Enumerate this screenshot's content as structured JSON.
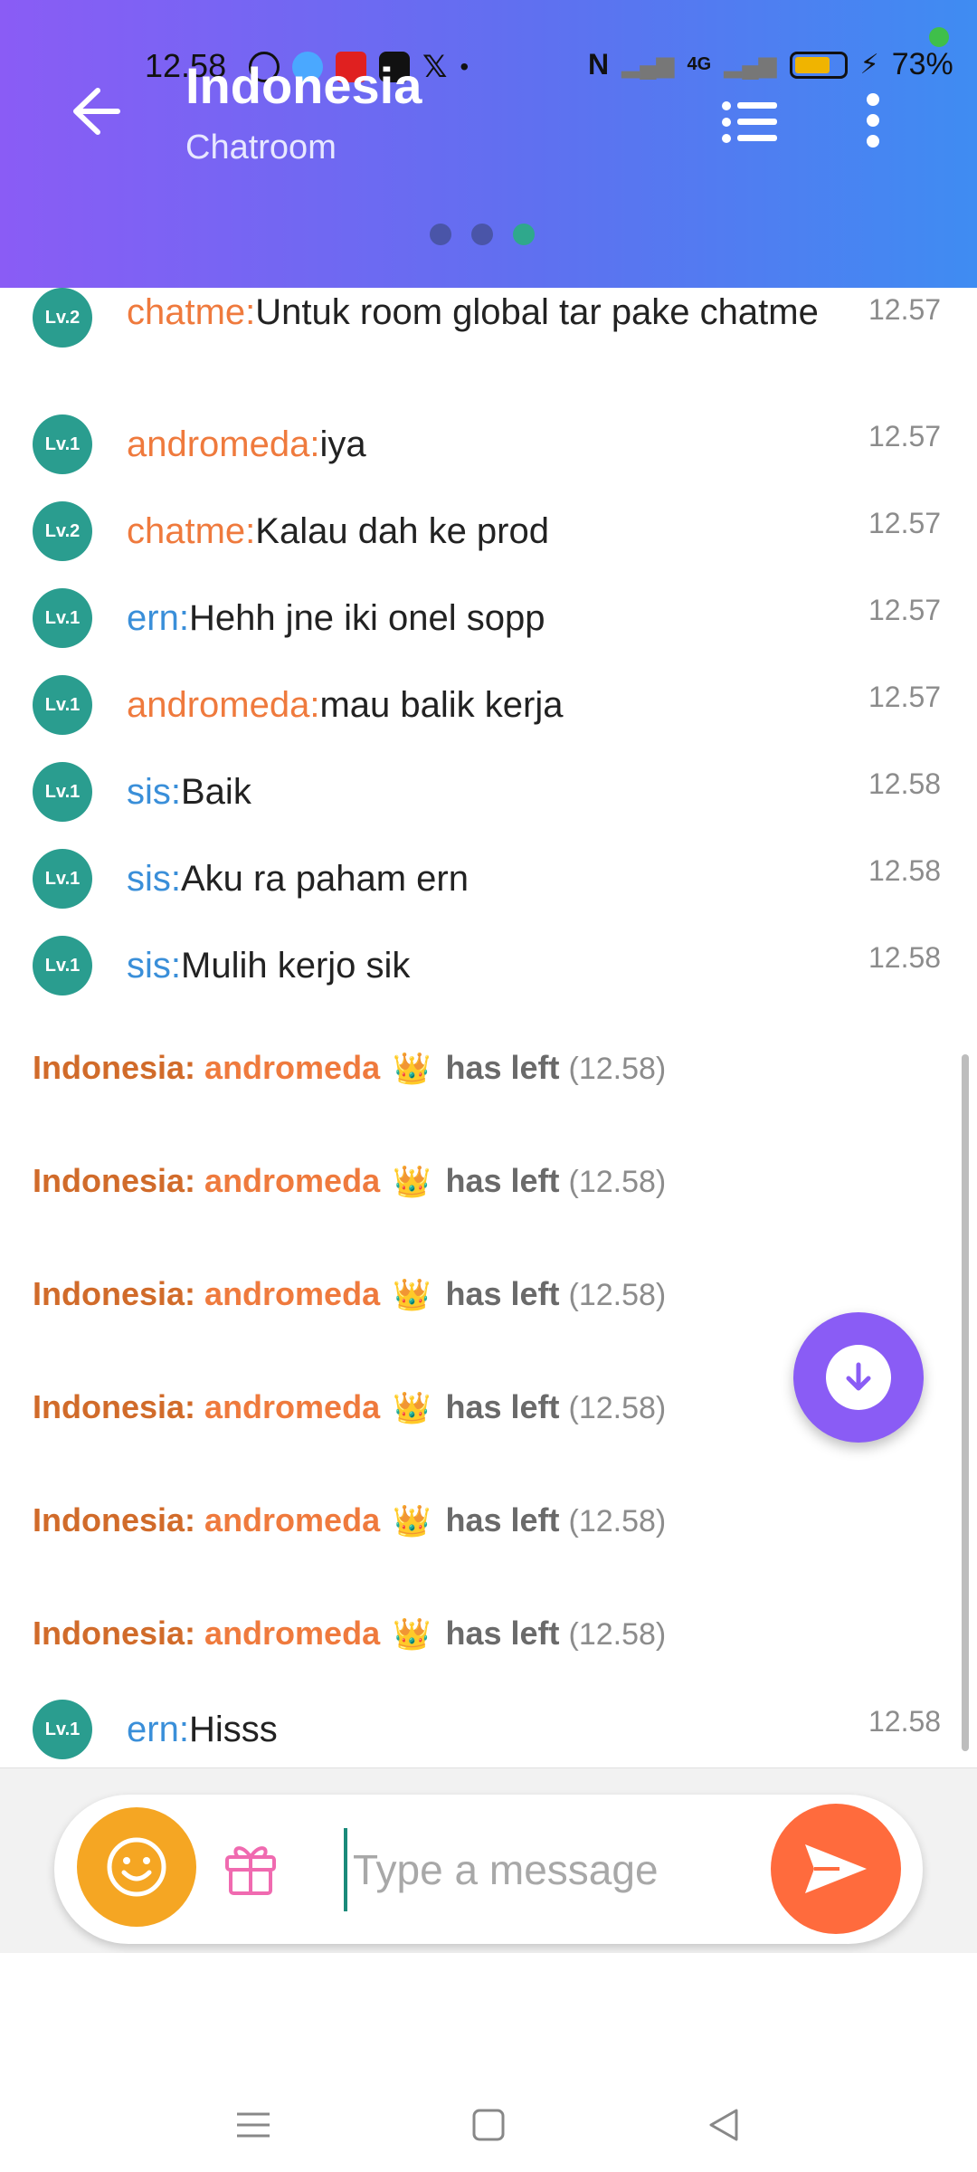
{
  "status_bar": {
    "time": "12.58",
    "battery_percent": "73%",
    "network": "4G",
    "battery_level": 0.73
  },
  "header": {
    "title": "Indonesia",
    "subtitle": "Chatroom",
    "pager_count": 3,
    "pager_active": 2
  },
  "messages": [
    {
      "level": "Lv.2",
      "user": "chatme:",
      "text": "Untuk room global tar pake chatme",
      "time": "12.57",
      "user_color": "orange"
    },
    {
      "level": "Lv.1",
      "user": "andromeda:",
      "text": "iya",
      "time": "12.57",
      "user_color": "orange"
    },
    {
      "level": "Lv.2",
      "user": "chatme:",
      "text": "Kalau dah ke prod",
      "time": "12.57",
      "user_color": "orange"
    },
    {
      "level": "Lv.1",
      "user": "ern:",
      "text": "Hehh jne iki onel sopp",
      "time": "12.57",
      "user_color": "blue"
    },
    {
      "level": "Lv.1",
      "user": "andromeda:",
      "text": "mau balik kerja",
      "time": "12.57",
      "user_color": "orange"
    },
    {
      "level": "Lv.1",
      "user": "sis:",
      "text": "Baik",
      "time": "12.58",
      "user_color": "blue"
    },
    {
      "level": "Lv.1",
      "user": "sis:",
      "text": "Aku ra paham ern",
      "time": "12.58",
      "user_color": "blue"
    },
    {
      "level": "Lv.1",
      "user": "sis:",
      "text": "Mulih kerjo sik",
      "time": "12.58",
      "user_color": "blue"
    }
  ],
  "system_messages": [
    {
      "room": "Indonesia:",
      "name": "andromeda",
      "crown": "👑",
      "action": "has left",
      "time": "(12.58)"
    },
    {
      "room": "Indonesia:",
      "name": "andromeda",
      "crown": "👑",
      "action": "has left",
      "time": "(12.58)"
    },
    {
      "room": "Indonesia:",
      "name": "andromeda",
      "crown": "👑",
      "action": "has left",
      "time": "(12.58)"
    },
    {
      "room": "Indonesia:",
      "name": "andromeda",
      "crown": "👑",
      "action": "has left",
      "time": "(12.58)"
    },
    {
      "room": "Indonesia:",
      "name": "andromeda",
      "crown": "👑",
      "action": "has left",
      "time": "(12.58)"
    },
    {
      "room": "Indonesia:",
      "name": "andromeda",
      "crown": "👑",
      "action": "has left",
      "time": "(12.58)"
    }
  ],
  "last_message": {
    "level": "Lv.1",
    "user": "ern:",
    "text": "Hisss",
    "time": "12.58",
    "user_color": "blue"
  },
  "composer": {
    "placeholder": "Type a message",
    "value": ""
  },
  "icons": {
    "back": "arrow-left-icon",
    "list": "list-icon",
    "more": "more-vert-icon",
    "scroll_down": "arrow-down-icon",
    "emoji": "smiley-icon",
    "gift": "gift-icon",
    "send": "send-icon",
    "nav_menu": "menu-icon",
    "nav_home": "square-icon",
    "nav_back": "triangle-back-icon"
  },
  "colors": {
    "accent_purple": "#8a5cf5",
    "accent_blue": "#3f8cf2",
    "level_badge": "#2a9d8f",
    "emoji_button": "#f5a623",
    "send_button": "#ff6b3d"
  }
}
